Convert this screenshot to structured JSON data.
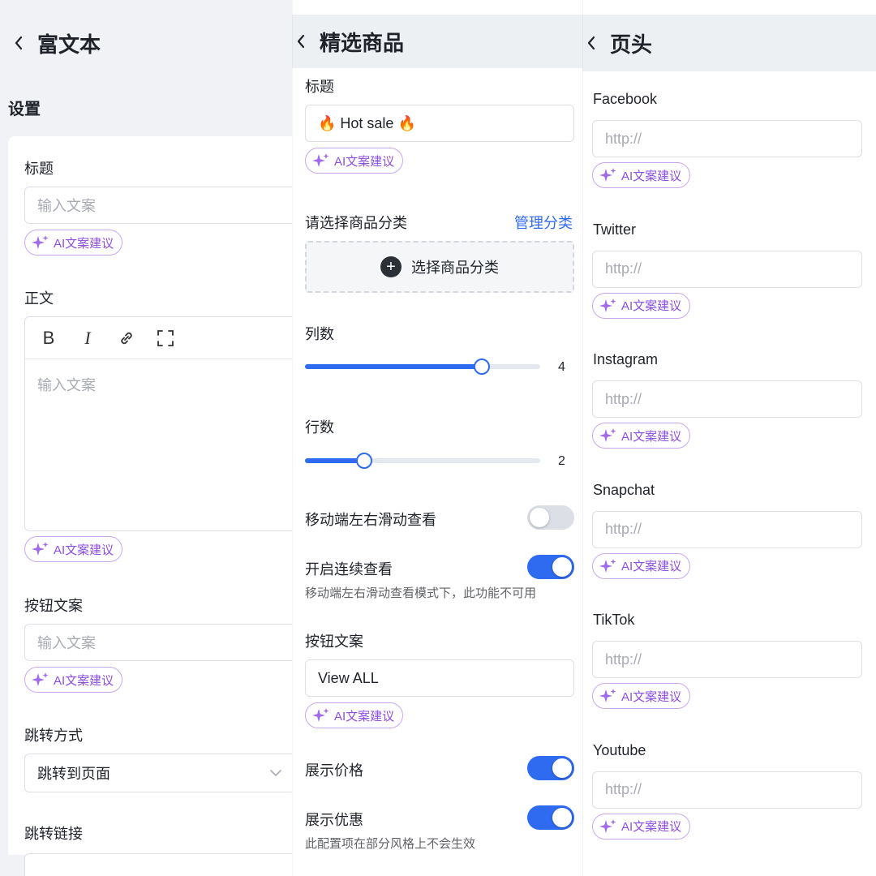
{
  "rich_text": {
    "header_title": "富文本",
    "section_title": "设置",
    "title_label": "标题",
    "title_placeholder": "输入文案",
    "body_label": "正文",
    "editor_placeholder": "输入文案",
    "toolbar": {
      "bold": "B",
      "italic": "I"
    },
    "button_text_label": "按钮文案",
    "button_text_placeholder": "输入文案",
    "jump_mode_label": "跳转方式",
    "jump_mode_value": "跳转到页面",
    "jump_link_label": "跳转链接",
    "ai_label": "AI文案建议"
  },
  "featured": {
    "header_title": "精选商品",
    "title_label": "标题",
    "title_value": "🔥 Hot sale 🔥",
    "ai_label": "AI文案建议",
    "category_label": "请选择商品分类",
    "manage_link": "管理分类",
    "select_category_button": "选择商品分类",
    "columns_label": "列数",
    "columns_value": "4",
    "columns_fraction": 0.75,
    "rows_label": "行数",
    "rows_value": "2",
    "rows_fraction": 0.25,
    "swipe_label": "移动端左右滑动查看",
    "swipe_on": false,
    "continuous_label": "开启连续查看",
    "continuous_on": true,
    "continuous_hint": "移动端左右滑动查看模式下，此功能不可用",
    "button_text_label": "按钮文案",
    "button_text_value": "View ALL",
    "show_price_label": "展示价格",
    "show_price_on": true,
    "show_discount_label": "展示优惠",
    "show_discount_on": true,
    "discount_hint": "此配置项在部分风格上不会生效"
  },
  "header_panel": {
    "header_title": "页头",
    "placeholder": "http://",
    "ai_label": "AI文案建议",
    "socials": [
      "Facebook",
      "Twitter",
      "Instagram",
      "Snapchat",
      "TikTok",
      "Youtube"
    ]
  },
  "colors": {
    "accent": "#2f6bf0",
    "ai_purple": "#8e4ee0",
    "border": "#dcdfe6",
    "header_bg": "#edf0f3"
  }
}
